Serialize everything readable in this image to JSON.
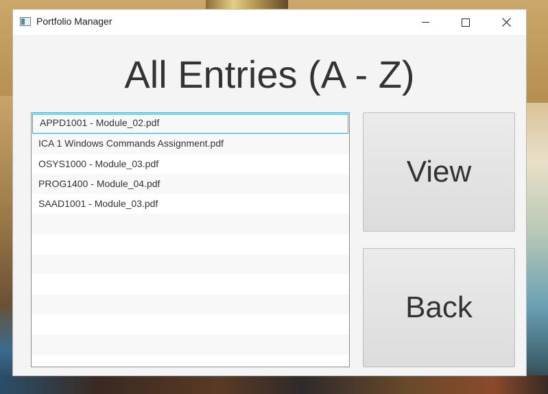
{
  "window": {
    "title": "Portfolio Manager",
    "controls": {
      "minimize": "minimize",
      "maximize": "maximize",
      "close": "close"
    }
  },
  "page": {
    "heading": "All Entries (A - Z)"
  },
  "entries": [
    "APPD1001 - Module_02.pdf",
    "ICA 1 Windows Commands Assignment.pdf",
    "OSYS1000 - Module_03.pdf",
    "PROG1400 - Module_04.pdf",
    "SAAD1001 - Module_03.pdf"
  ],
  "selected_index": 0,
  "buttons": {
    "view_label": "View",
    "back_label": "Back"
  },
  "colors": {
    "accent": "#3fa3d0",
    "window_bg": "#f4f4f4",
    "text": "#333333"
  }
}
